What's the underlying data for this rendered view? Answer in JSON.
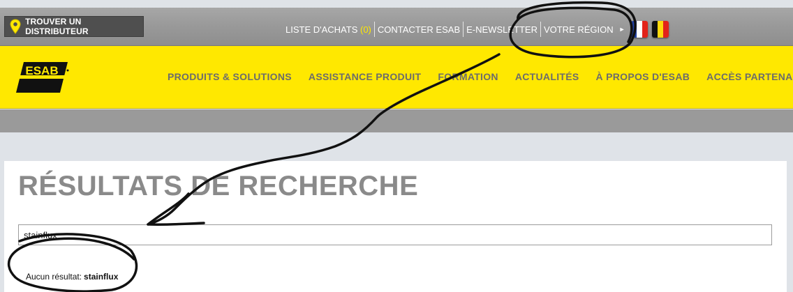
{
  "topbar": {
    "find_dealer_label": "TROUVER UN DISTRIBUTEUR",
    "find_dealer_icon": "map-pin-icon",
    "links": {
      "shopping_list_label": "LISTE D'ACHATS",
      "shopping_list_count": "(0)",
      "contact_label": "CONTACTER ESAB",
      "newsletter_label": "E-NEWSLETTER",
      "region_label": "VOTRE RÉGION"
    },
    "flags": [
      "France",
      "Belgique"
    ]
  },
  "brand": {
    "logo_text": "ESAB",
    "color_yellow": "#ffe800",
    "color_grey": "#9a9a9a"
  },
  "nav": {
    "items": [
      "PRODUITS & SOLUTIONS",
      "ASSISTANCE PRODUIT",
      "FORMATION",
      "ACTUALITÉS",
      "À PROPOS D'ESAB",
      "ACCÈS PARTENAIRES"
    ]
  },
  "main": {
    "title": "RÉSULTATS DE RECHERCHE",
    "search_value": "stainflux",
    "no_result_label": "Aucun résultat:",
    "no_result_term": "stainflux"
  }
}
